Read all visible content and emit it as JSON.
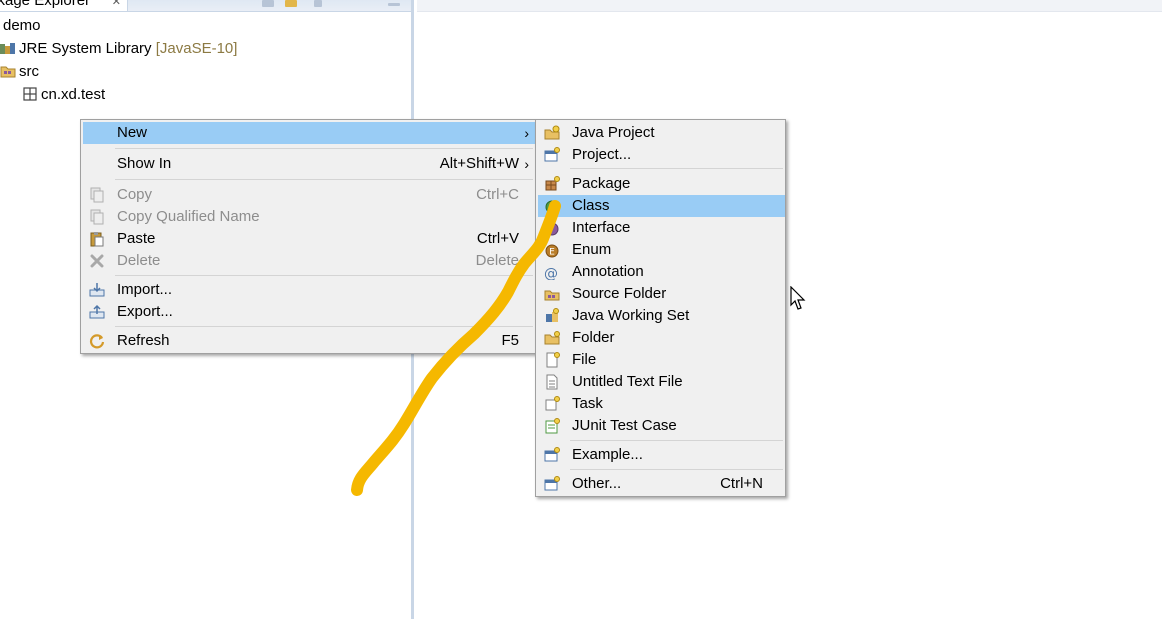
{
  "explorer": {
    "tab_title": "ckage Explorer",
    "tab_close": "✕",
    "tree": {
      "project": "demo",
      "library": "JRE System Library",
      "library_decoration": "[JavaSE-10]",
      "src": "src",
      "package": "cn.xd.test"
    }
  },
  "context_menu": {
    "items": [
      {
        "label": "New",
        "shortcut": "",
        "submenu": "›"
      },
      {
        "label": "Show In",
        "shortcut": "Alt+Shift+W",
        "submenu": "›"
      },
      {
        "label": "Copy",
        "shortcut": "Ctrl+C"
      },
      {
        "label": "Copy Qualified Name",
        "shortcut": ""
      },
      {
        "label": "Paste",
        "shortcut": "Ctrl+V"
      },
      {
        "label": "Delete",
        "shortcut": "Delete"
      },
      {
        "label": "Import...",
        "shortcut": ""
      },
      {
        "label": "Export...",
        "shortcut": ""
      },
      {
        "label": "Refresh",
        "shortcut": "F5"
      }
    ]
  },
  "new_submenu": {
    "items": [
      {
        "label": "Java Project"
      },
      {
        "label": "Project..."
      },
      {
        "label": "Package"
      },
      {
        "label": "Class"
      },
      {
        "label": "Interface"
      },
      {
        "label": "Enum"
      },
      {
        "label": "Annotation"
      },
      {
        "label": "Source Folder"
      },
      {
        "label": "Java Working Set"
      },
      {
        "label": "Folder"
      },
      {
        "label": "File"
      },
      {
        "label": "Untitled Text File"
      },
      {
        "label": "Task"
      },
      {
        "label": "JUnit Test Case"
      },
      {
        "label": "Example..."
      },
      {
        "label": "Other...",
        "shortcut": "Ctrl+N"
      }
    ]
  },
  "colors": {
    "menu_background": "#f0f0f0",
    "selection": "#99ccf5",
    "disabled_text": "#8d8d8d",
    "annotation_stroke": "#f5b800",
    "decoration_text": "#8c7a43"
  }
}
